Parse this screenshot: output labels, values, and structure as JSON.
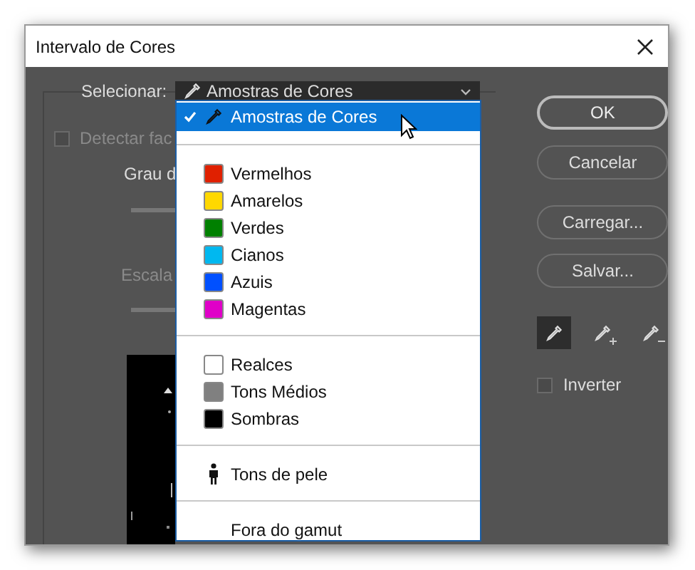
{
  "window": {
    "title": "Intervalo de Cores"
  },
  "selector": {
    "label": "Selecionar:",
    "value": "Amostras de Cores"
  },
  "detect_faces": {
    "label": "Detectar fac",
    "checked": false
  },
  "fuzziness": {
    "label": "Grau d"
  },
  "range": {
    "label": "Escala"
  },
  "menu": {
    "groups": [
      {
        "items": [
          {
            "kind": "sample",
            "label": "Amostras de Cores",
            "selected": true
          }
        ]
      },
      {
        "items": [
          {
            "kind": "swatch",
            "label": "Vermelhos",
            "color": "#e02000",
            "selected": false
          },
          {
            "kind": "swatch",
            "label": "Amarelos",
            "color": "#ffd800",
            "selected": false
          },
          {
            "kind": "swatch",
            "label": "Verdes",
            "color": "#008000",
            "selected": false
          },
          {
            "kind": "swatch",
            "label": "Cianos",
            "color": "#00b8f0",
            "selected": false
          },
          {
            "kind": "swatch",
            "label": "Azuis",
            "color": "#0050ff",
            "selected": false
          },
          {
            "kind": "swatch",
            "label": "Magentas",
            "color": "#e000c8",
            "selected": false
          }
        ]
      },
      {
        "items": [
          {
            "kind": "swatch",
            "label": "Realces",
            "color": "#ffffff",
            "selected": false
          },
          {
            "kind": "swatch",
            "label": "Tons Médios",
            "color": "#808080",
            "selected": false
          },
          {
            "kind": "swatch",
            "label": "Sombras",
            "color": "#000000",
            "selected": false
          }
        ]
      },
      {
        "items": [
          {
            "kind": "skin",
            "label": "Tons de pele",
            "selected": false
          }
        ]
      },
      {
        "items": [
          {
            "kind": "plain",
            "label": "Fora do gamut",
            "selected": false
          }
        ]
      }
    ]
  },
  "buttons": [
    {
      "label": "OK",
      "default": true
    },
    {
      "label": "Cancelar",
      "default": false
    },
    {
      "label": "Carregar...",
      "default": false
    },
    {
      "label": "Salvar...",
      "default": false
    }
  ],
  "tools": [
    {
      "kind": "sample",
      "selected": true
    },
    {
      "kind": "add",
      "selected": false
    },
    {
      "kind": "subtract",
      "selected": false
    }
  ],
  "invert": {
    "label": "Inverter",
    "checked": false
  }
}
